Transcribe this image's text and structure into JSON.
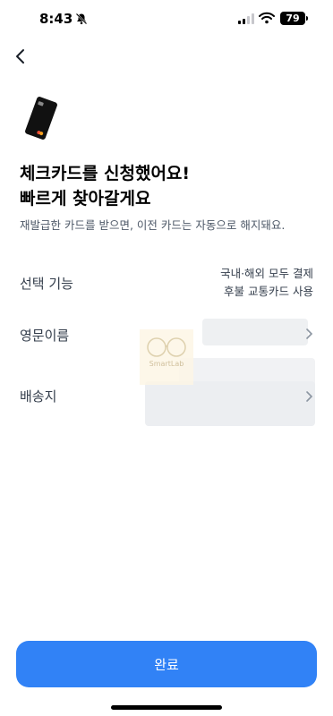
{
  "status_bar": {
    "time": "8:43",
    "battery": "79"
  },
  "header": {
    "back_icon": "chevron-left-icon"
  },
  "card": {
    "icon": "debit-card-icon"
  },
  "title": {
    "line1": "체크카드를 신청했어요!",
    "line2": "빠르게 찾아갈게요"
  },
  "subtitle": "재발급한 카드를 받으면, 이전 카드는 자동으로 해지돼요.",
  "rows": {
    "features": {
      "label": "선택 기능",
      "values": [
        "국내·해외 모두 결제",
        "후불 교통카드 사용"
      ]
    },
    "english_name": {
      "label": "영문이름"
    },
    "delivery": {
      "label": "배송지"
    }
  },
  "watermark": "SmartLab",
  "footer": {
    "done_label": "완료"
  },
  "colors": {
    "primary": "#3182f6",
    "text": "#191f28",
    "subtext": "#4e5968"
  }
}
